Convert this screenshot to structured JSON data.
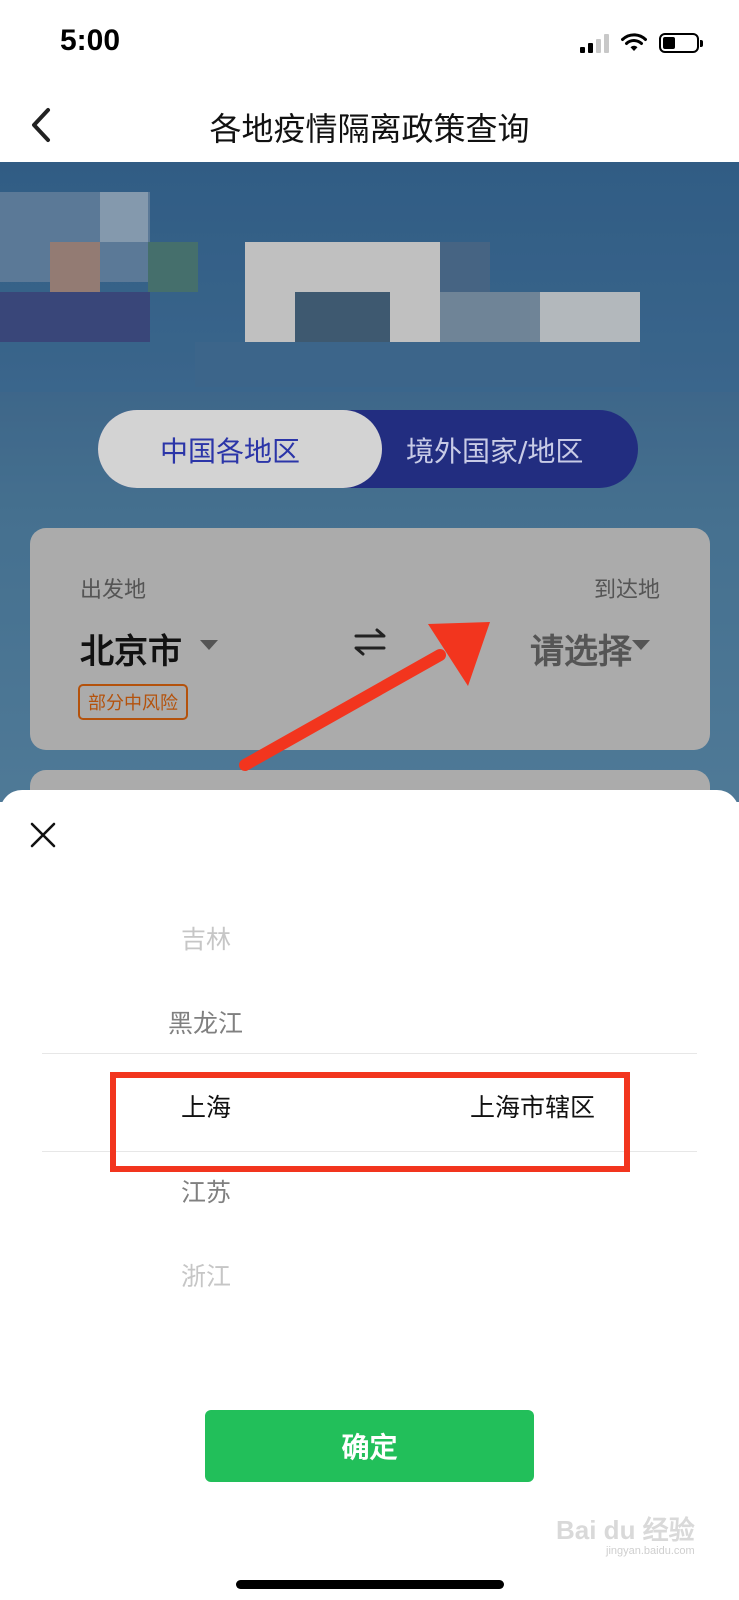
{
  "status_bar": {
    "time": "5:00"
  },
  "header": {
    "title": "各地疫情隔离政策查询"
  },
  "tabs": [
    {
      "label": "中国各地区",
      "active": true
    },
    {
      "label": "境外国家/地区",
      "active": false
    }
  ],
  "route": {
    "from_label": "出发地",
    "from_value": "北京市",
    "risk_badge": "部分中风险",
    "to_label": "到达地",
    "to_value": "请选择"
  },
  "picker": {
    "provinces": [
      "吉林",
      "黑龙江",
      "上海",
      "江苏",
      "浙江"
    ],
    "selected_province": "上海",
    "selected_city": "上海市辖区",
    "confirm_label": "确定"
  },
  "watermark": {
    "brand": "Bai du 经验",
    "url": "jingyan.baidu.com"
  },
  "colors": {
    "confirm_green": "#22bf5a",
    "highlight_red": "#f2351e",
    "tab_active_text": "#2b35a8",
    "tab_bg": "#222d80",
    "risk_orange": "#b4520c"
  }
}
